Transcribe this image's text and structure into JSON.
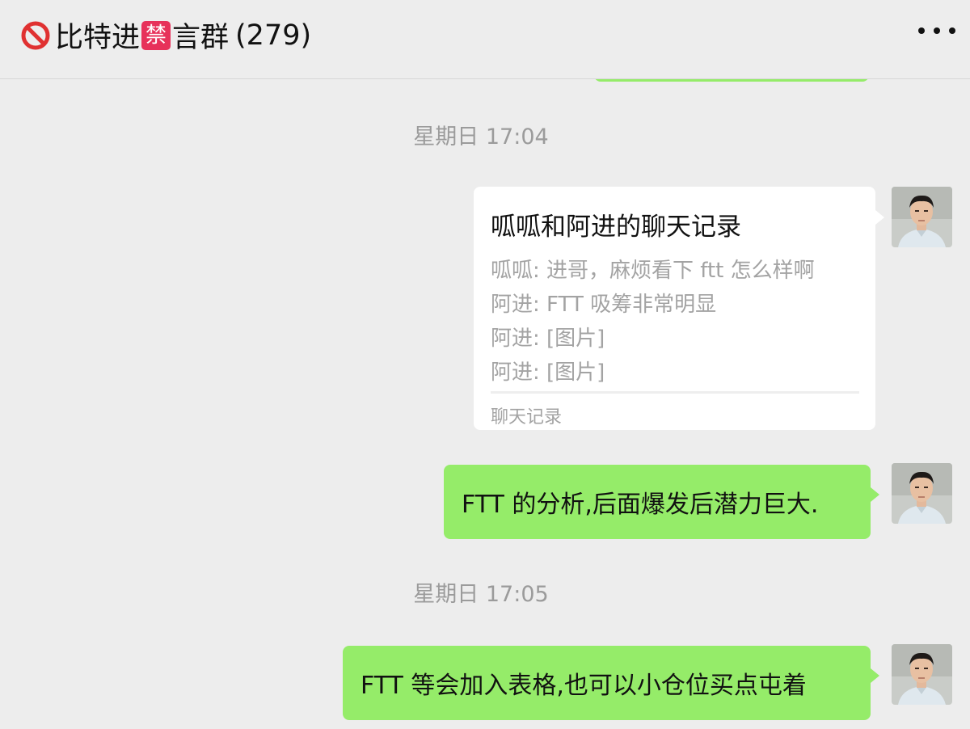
{
  "header": {
    "title": "比特进禁言群",
    "title_prefix": "比特进",
    "title_badge": "禁",
    "title_suffix": "言群",
    "member_count": "(279)",
    "more_icon": "more-dots-icon"
  },
  "messages": {
    "time_1": "星期日 17:04",
    "chat_record": {
      "title": "呱呱和阿进的聊天记录",
      "lines": [
        "呱呱: 进哥，麻烦看下 ftt 怎么样啊",
        "阿进: FTT 吸筹非常明显",
        "阿进: [图片]",
        "阿进: [图片]"
      ],
      "footer": "聊天记录"
    },
    "msg_1": "FTT 的分析,后面爆发后潜力巨大.",
    "time_2": "星期日 17:05",
    "msg_2": "FTT 等会加入表格,也可以小仓位买点屯着"
  },
  "colors": {
    "background": "#ededed",
    "bubble_green": "#95ec69",
    "card_white": "#ffffff",
    "muted_text": "#9b9b9b",
    "forbidden_red": "#e7315a"
  }
}
